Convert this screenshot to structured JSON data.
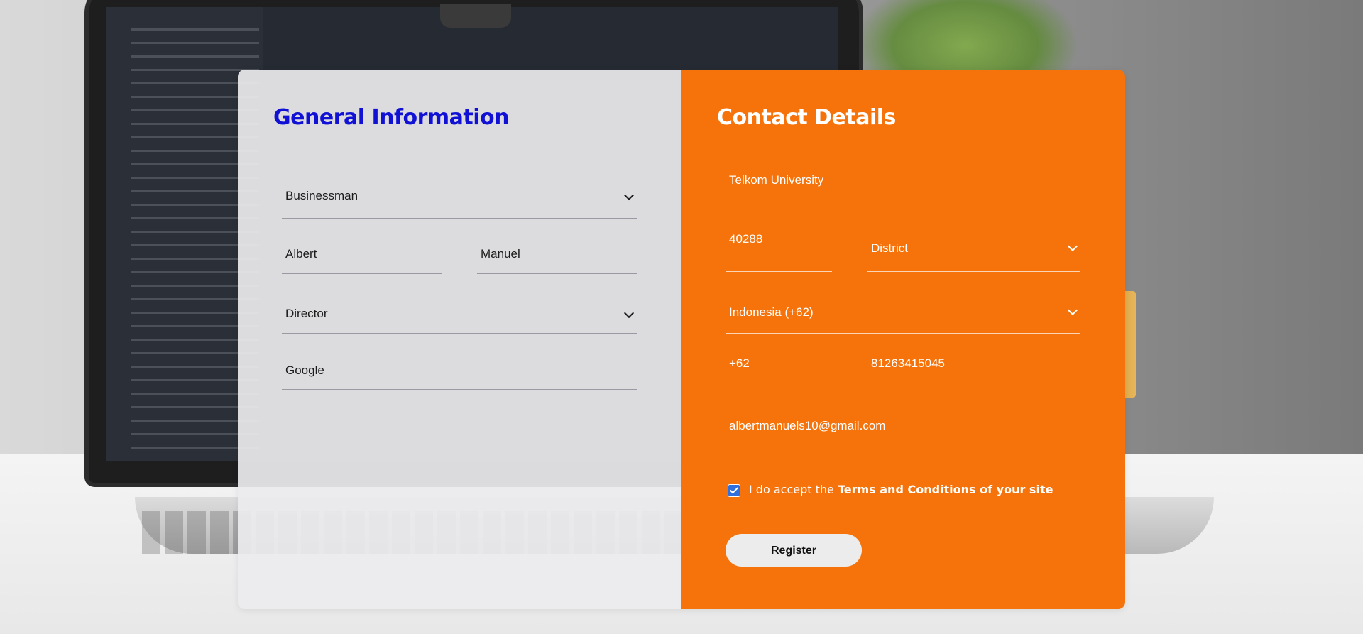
{
  "general": {
    "title": "General Information",
    "title_select": "Businessman",
    "first_name": "Albert",
    "last_name": "Manuel",
    "position_select": "Director",
    "company": "Google"
  },
  "contact": {
    "title": "Contact Details",
    "street": "Telkom University",
    "zip": "40288",
    "district_select": "District",
    "country_select": "Indonesia (+62)",
    "phone_code": "+62",
    "phone_number": "81263415045",
    "email": "albertmanuels10@gmail.com",
    "terms_prefix": "I do accept the",
    "terms_bold": "Terms and Conditions of your site",
    "register_label": "Register"
  },
  "colors": {
    "accent": "#f5730a",
    "title_blue": "#1111d6",
    "checkbox": "#2f6fe0"
  },
  "icons": [
    "chevron-down-icon",
    "check-icon"
  ]
}
